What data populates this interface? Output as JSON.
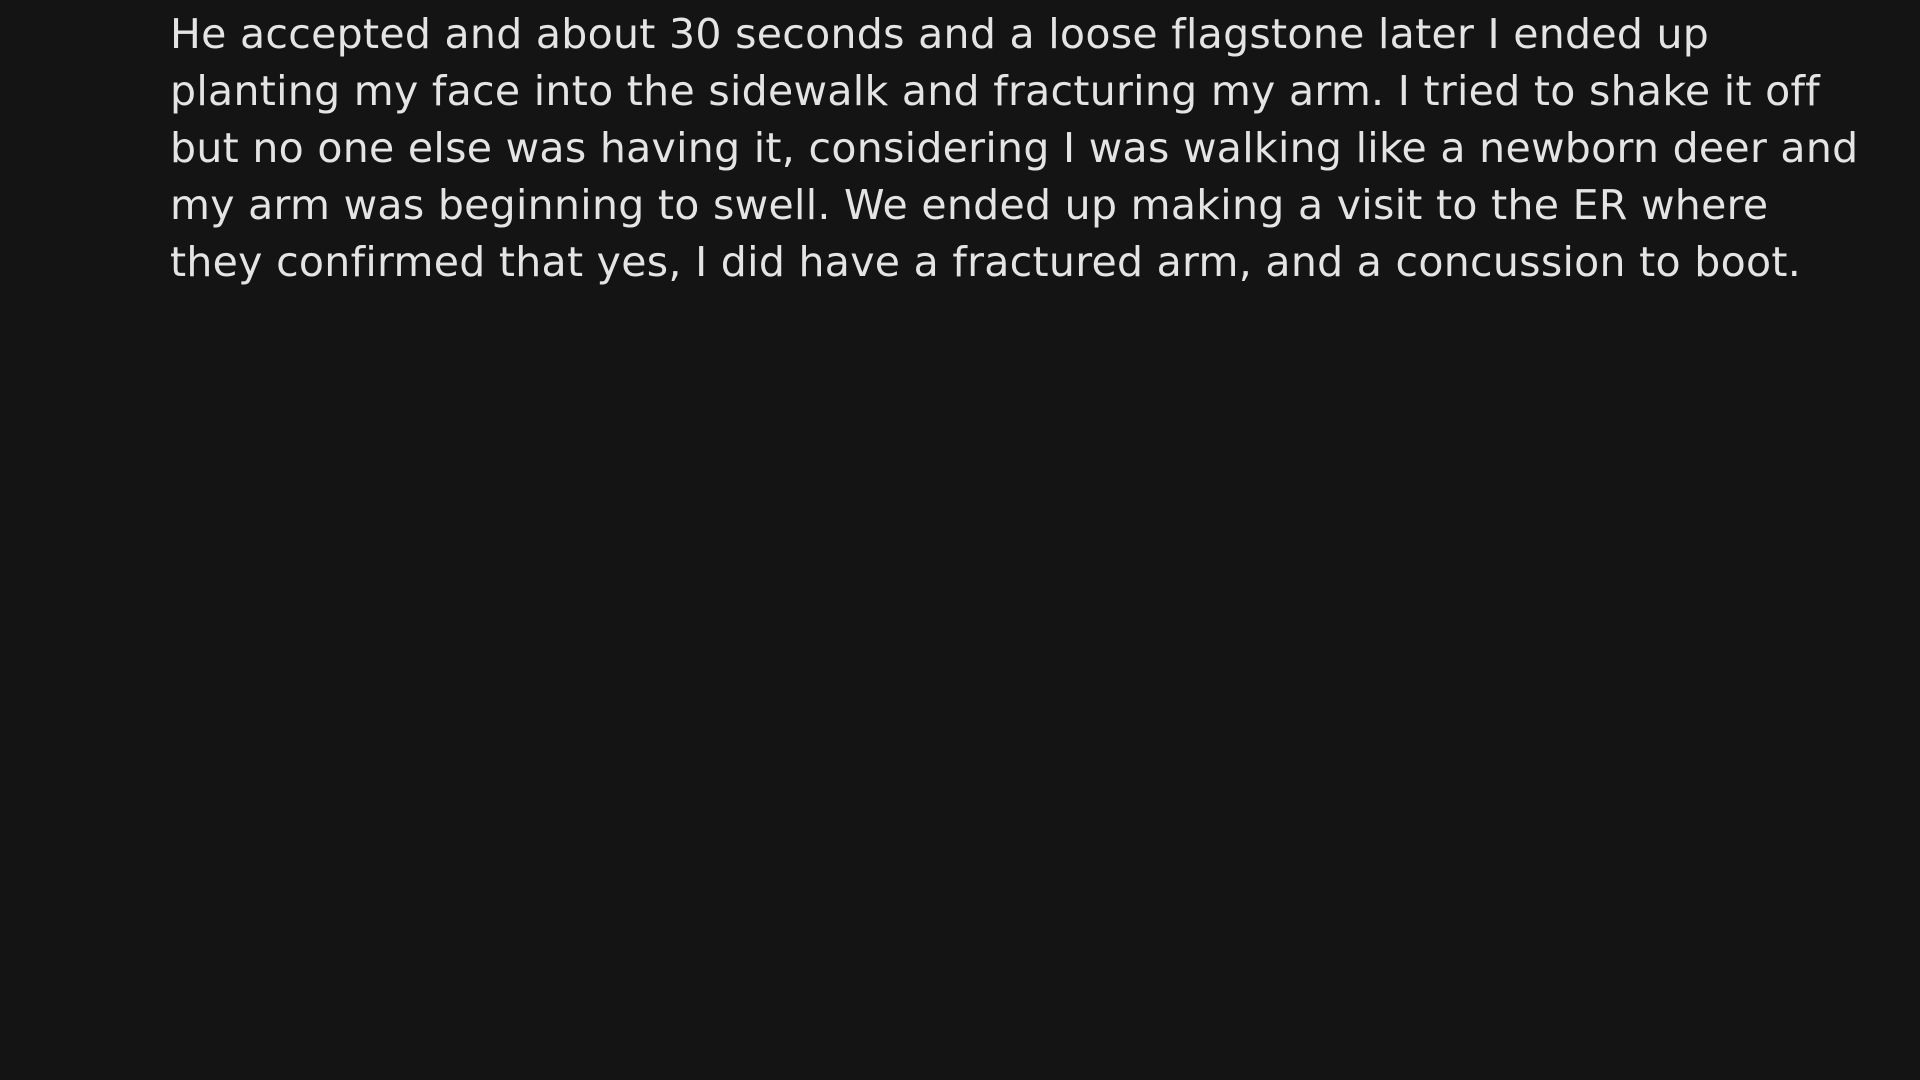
{
  "story": {
    "lines": [
      "He accepted and about 30 seconds and a loose flagstone later I ended up",
      "planting my face into the sidewalk and fracturing my arm. I tried to shake it off",
      "but no one else was having it, considering I was walking like a newborn deer and",
      "my arm was beginning to swell. We ended up making a visit to the ER where",
      "they confirmed that yes, I did have a fractured arm, and a concussion to boot."
    ]
  },
  "colors": {
    "background": "#141414",
    "text": "#e4e4e4"
  }
}
